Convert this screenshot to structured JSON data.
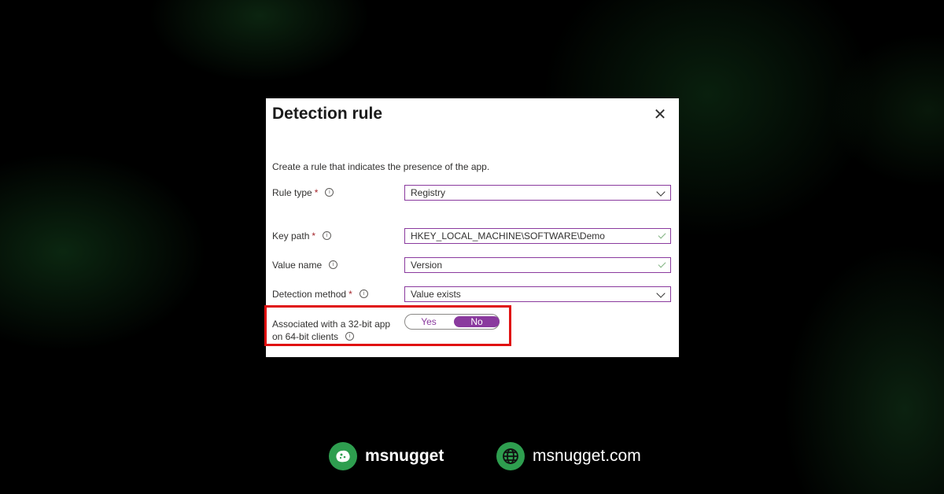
{
  "dialog": {
    "title": "Detection rule",
    "close_icon": "close-icon",
    "description": "Create a rule that indicates the presence of the app.",
    "rule_type": {
      "label": "Rule type",
      "required": "*",
      "value": "Registry"
    },
    "key_path": {
      "label": "Key path",
      "required": "*",
      "value": "HKEY_LOCAL_MACHINE\\SOFTWARE\\Demo"
    },
    "value_name": {
      "label": "Value name",
      "value": "Version"
    },
    "detection_method": {
      "label": "Detection method",
      "required": "*",
      "value": "Value exists"
    },
    "associated": {
      "label_line1": "Associated with a 32-bit app",
      "label_line2": "on 64-bit clients",
      "yes": "Yes",
      "no": "No",
      "selected": "No"
    }
  },
  "colors": {
    "accent": "#8a3a9e",
    "highlight": "#e01010",
    "brand_green": "#2e9e4f"
  },
  "footer": {
    "brand_name": "msnugget",
    "website": "msnugget.com"
  }
}
